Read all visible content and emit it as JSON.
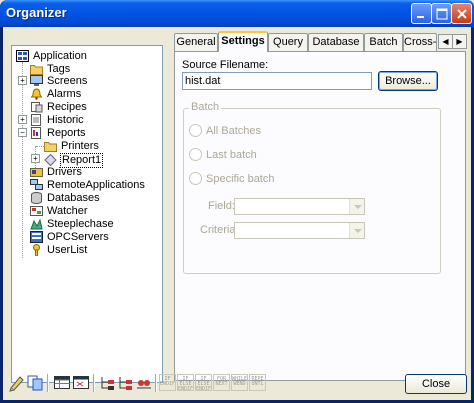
{
  "window": {
    "title": "Organizer",
    "close_button_label": "Close"
  },
  "tree": {
    "items": [
      {
        "label": "Application",
        "icon": "application-icon"
      },
      {
        "label": "Tags",
        "icon": "folder-icon"
      },
      {
        "label": "Screens",
        "icon": "screen-icon"
      },
      {
        "label": "Alarms",
        "icon": "bell-icon"
      },
      {
        "label": "Recipes",
        "icon": "recipe-icon"
      },
      {
        "label": "Historic",
        "icon": "historic-icon"
      },
      {
        "label": "Reports",
        "icon": "report-icon"
      },
      {
        "label": "Printers",
        "icon": "folder-icon"
      },
      {
        "label": "Report1",
        "icon": "report-item-icon"
      },
      {
        "label": "Drivers",
        "icon": "driver-icon"
      },
      {
        "label": "RemoteApplications",
        "icon": "remote-icon"
      },
      {
        "label": "Databases",
        "icon": "database-icon"
      },
      {
        "label": "Watcher",
        "icon": "watcher-icon"
      },
      {
        "label": "Steeplechase",
        "icon": "steeplechase-icon"
      },
      {
        "label": "OPCServers",
        "icon": "opc-icon"
      },
      {
        "label": "UserList",
        "icon": "key-icon"
      }
    ]
  },
  "tabs": [
    {
      "label": "General"
    },
    {
      "label": "Settings"
    },
    {
      "label": "Query"
    },
    {
      "label": "Database"
    },
    {
      "label": "Batch"
    },
    {
      "label": "Cross-"
    }
  ],
  "settings": {
    "source_filename_label": "Source Filename:",
    "source_filename_value": "hist.dat",
    "browse_label": "Browse...",
    "batch_group_label": "Batch",
    "all_batches_label": "All Batches",
    "last_batch_label": "Last batch",
    "specific_batch_label": "Specific batch",
    "field_label": "Field:",
    "criteria_label": "Criteria:"
  },
  "toolbar": {
    "text_buttons": [
      "IF ENDIF",
      "IF ELSE ENDIF",
      "IF ELSE ENDIF",
      "FOR NEXT",
      "WHILE WEND",
      "REPE UNTL"
    ]
  },
  "colors": {
    "titlebar": "#0054e3",
    "active_tab_highlight": "#ffc83c",
    "window_face": "#ece9d8"
  }
}
